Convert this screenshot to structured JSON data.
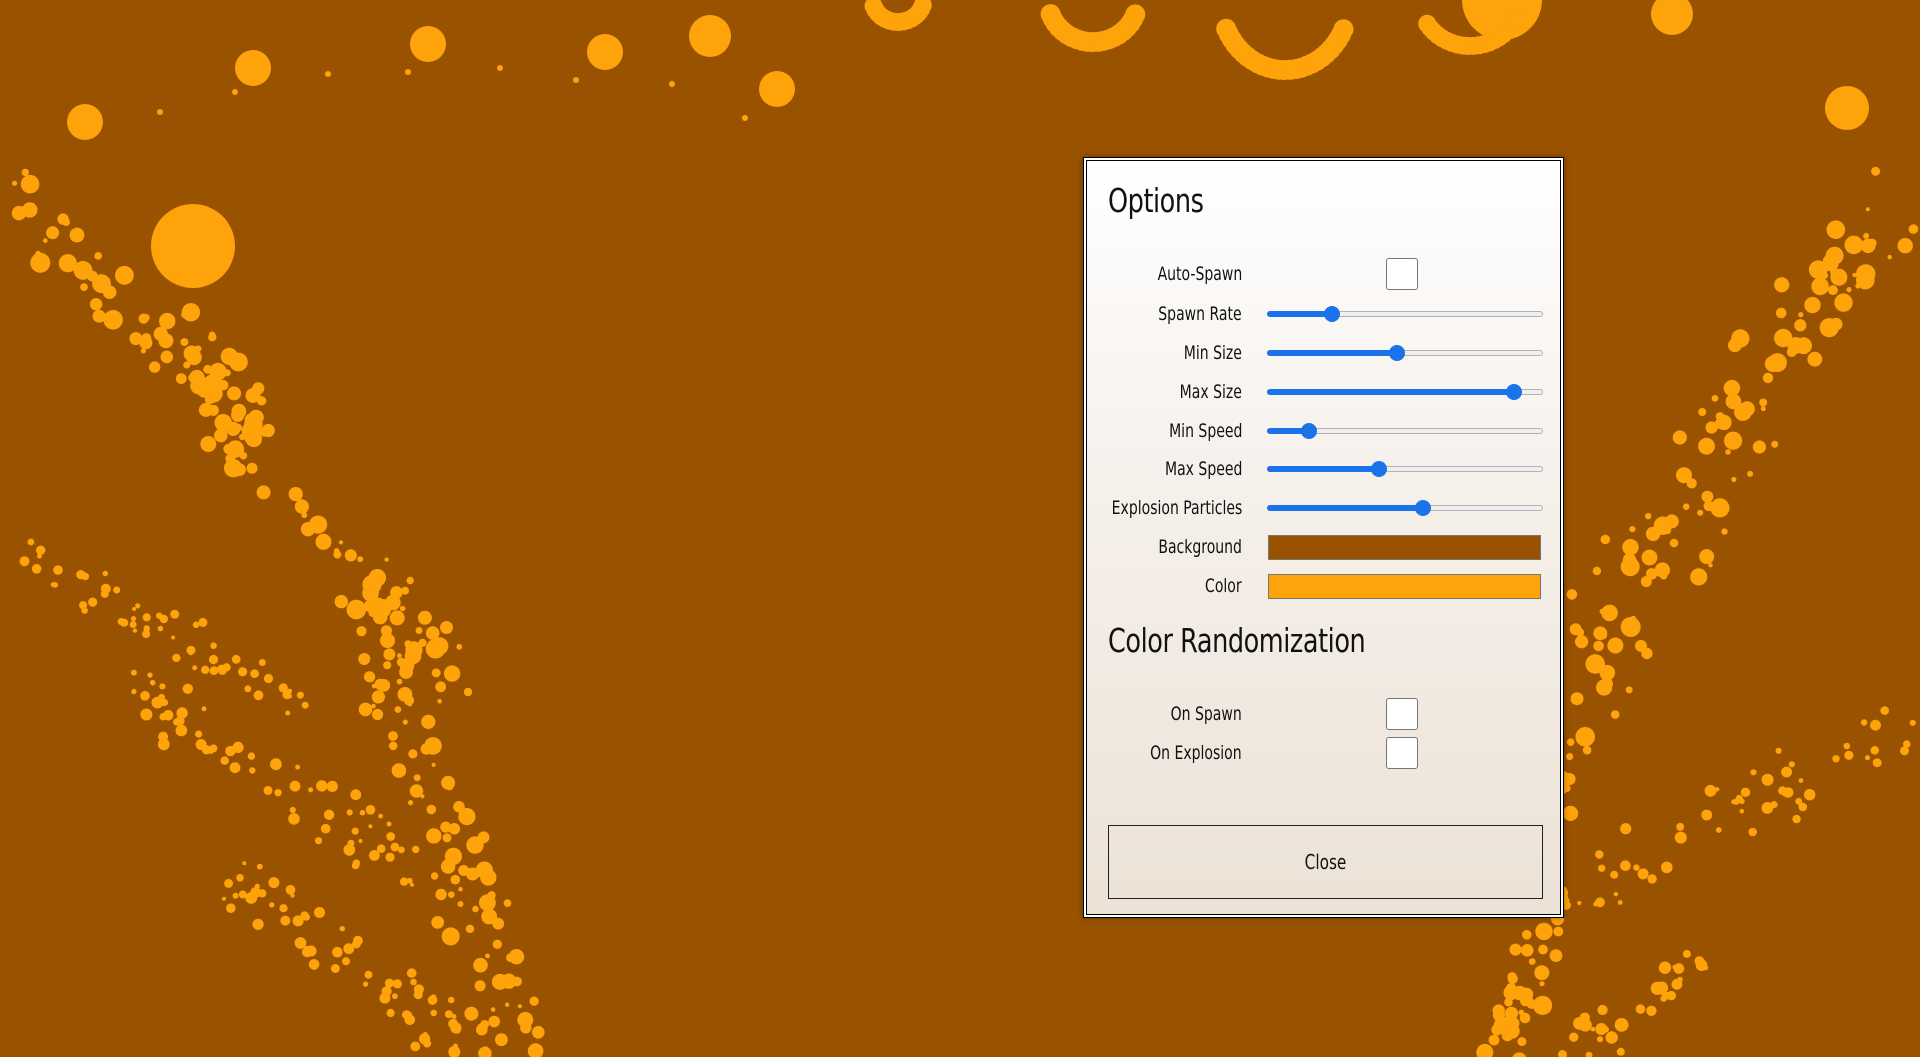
{
  "colors": {
    "background": "#995200",
    "particle": "#ffa30b",
    "accent": "#1a73e8"
  },
  "options": {
    "title": "Options",
    "auto_spawn": {
      "label": "Auto-Spawn",
      "checked": false
    },
    "sliders": [
      {
        "key": "spawn-rate",
        "label": "Spawn Rate",
        "fraction": 0.22
      },
      {
        "key": "min-size",
        "label": "Min Size",
        "fraction": 0.47
      },
      {
        "key": "max-size",
        "label": "Max Size",
        "fraction": 0.92
      },
      {
        "key": "min-speed",
        "label": "Min Speed",
        "fraction": 0.13
      },
      {
        "key": "max-speed",
        "label": "Max Speed",
        "fraction": 0.4
      },
      {
        "key": "explosion-particles",
        "label": "Explosion Particles",
        "fraction": 0.57
      }
    ],
    "background": {
      "label": "Background",
      "value": "#995200"
    },
    "color": {
      "label": "Color",
      "value": "#ffa30b"
    }
  },
  "randomization": {
    "title": "Color Randomization",
    "on_spawn": {
      "label": "On Spawn",
      "checked": false
    },
    "on_explosion": {
      "label": "On Explosion",
      "checked": false
    }
  },
  "close_label": "Close"
}
